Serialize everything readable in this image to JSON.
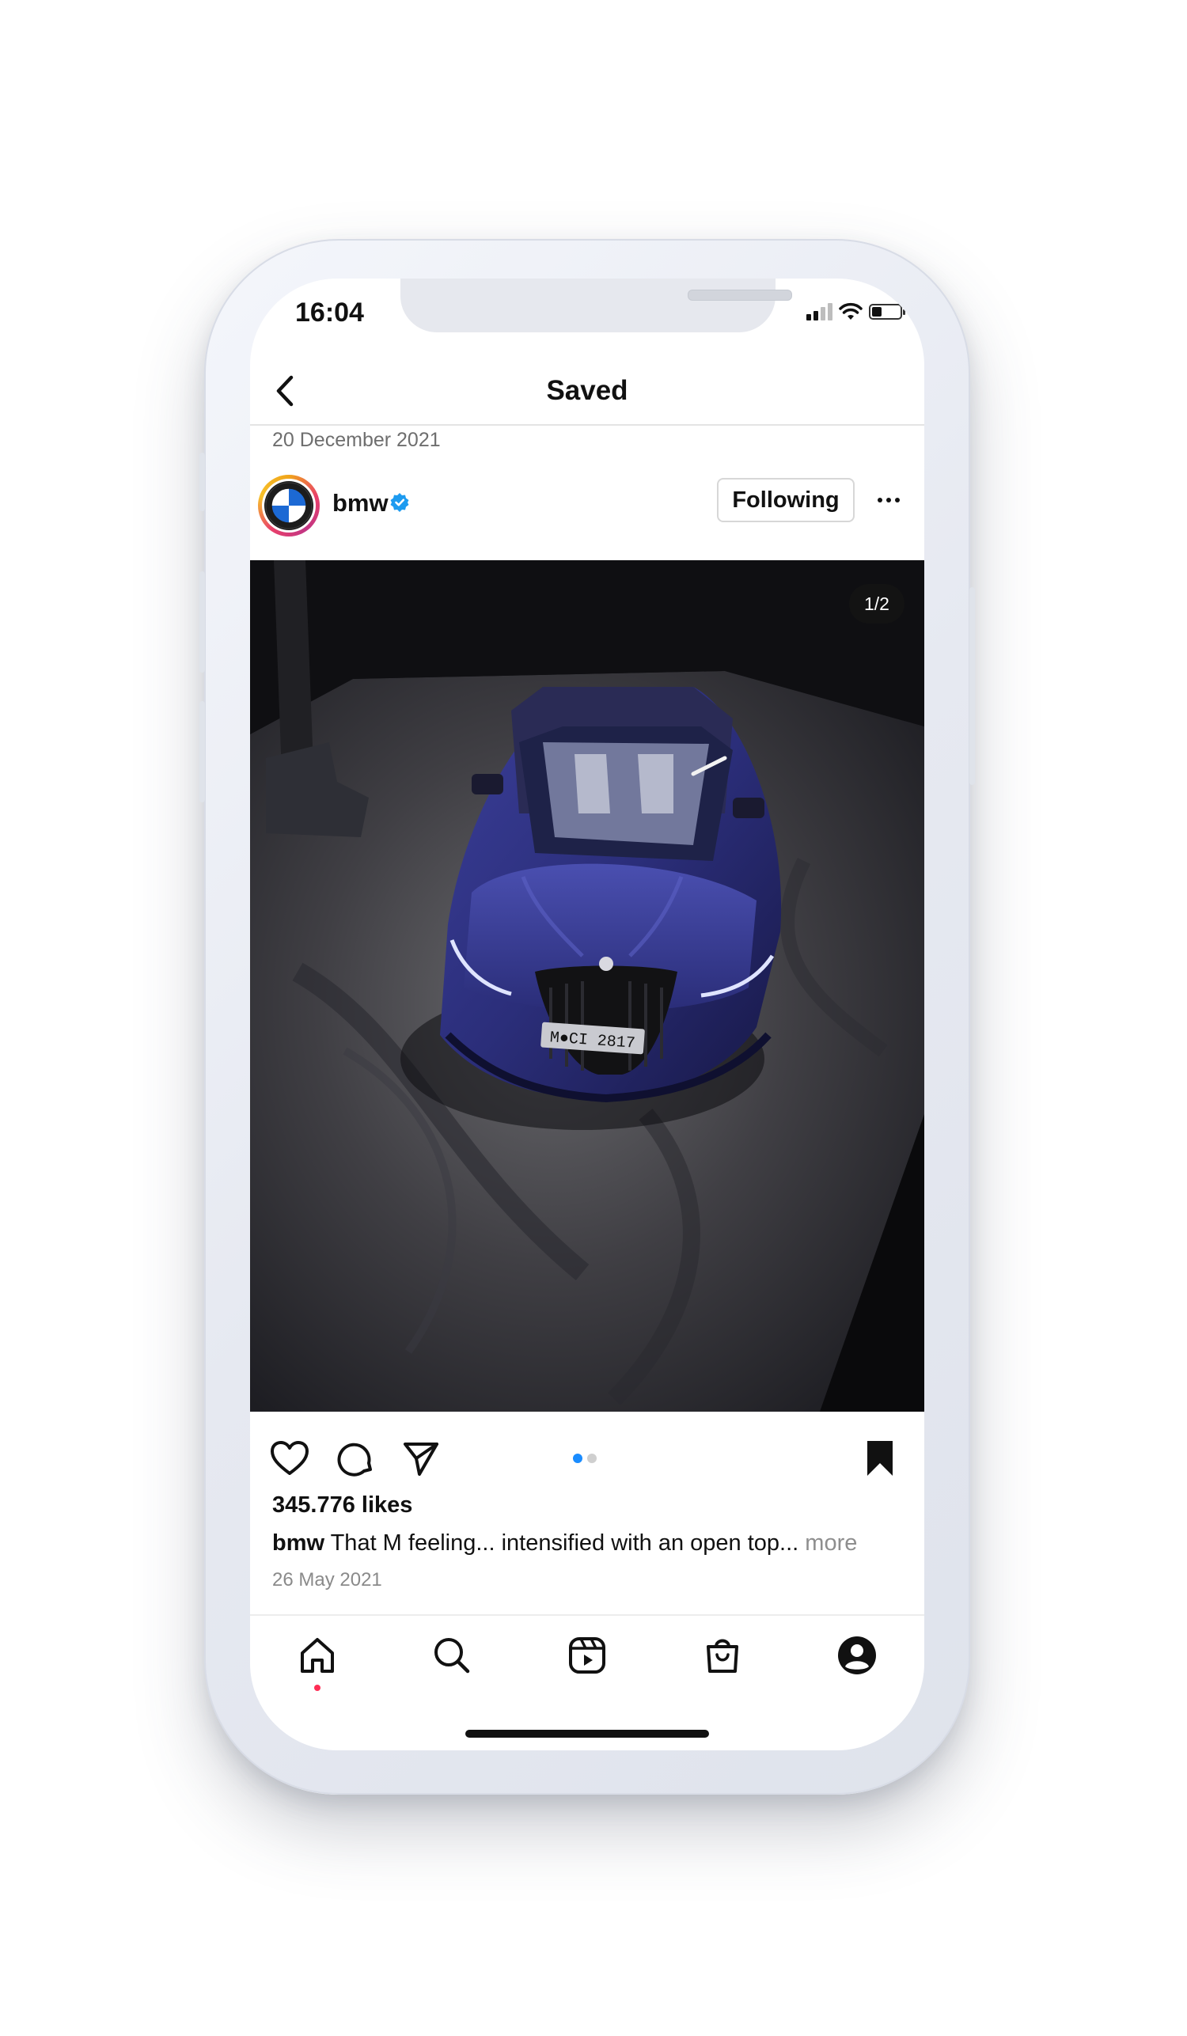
{
  "status_bar": {
    "time": "16:04"
  },
  "header": {
    "title": "Saved"
  },
  "saved_date": "20 December 2021",
  "post": {
    "username": "bmw",
    "follow_label": "Following",
    "image_counter": "1/2",
    "plate_text": "M●CI 2817",
    "likes": "345.776 likes",
    "caption_user": "bmw",
    "caption_text": " That M feeling... intensified with an open top... ",
    "caption_more": "more",
    "date": "26 May 2021"
  },
  "icons": {
    "back": "chevron-left-icon",
    "verified": "verified-badge-icon",
    "more": "ellipsis-icon",
    "like": "heart-icon",
    "comment": "comment-icon",
    "share": "send-icon",
    "save": "bookmark-filled-icon",
    "tabs": [
      "home-icon",
      "search-icon",
      "reels-icon",
      "shop-icon",
      "profile-icon"
    ]
  },
  "colors": {
    "verified_blue": "#1d9bf0",
    "carousel_active": "#1a8cff",
    "notification_dot": "#ff2d55",
    "car_blue": "#2b2e7a"
  }
}
